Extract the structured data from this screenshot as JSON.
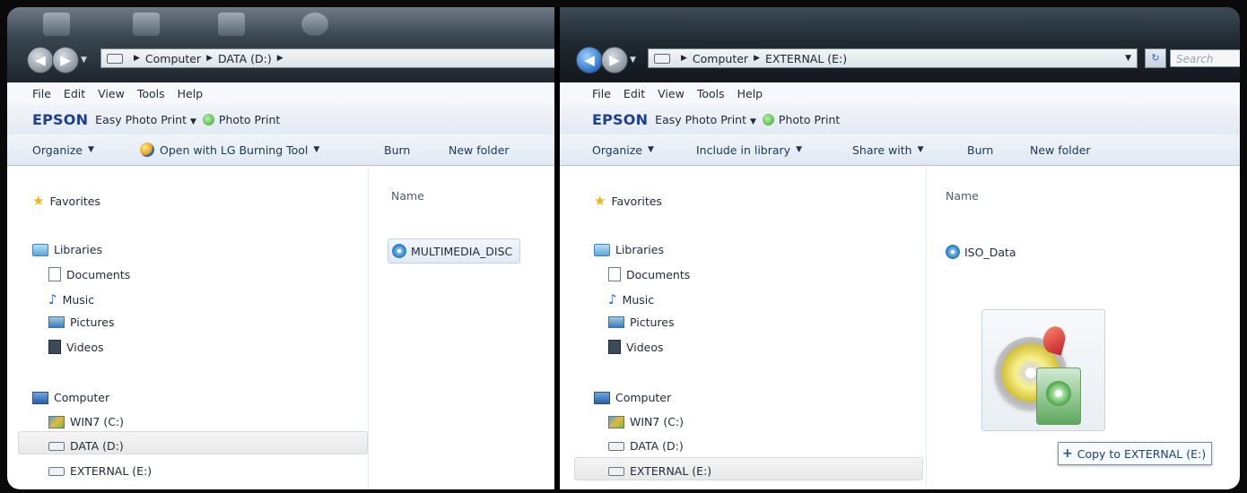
{
  "left_window": {
    "address": [
      "Computer",
      "DATA (D:)"
    ],
    "menu": [
      "File",
      "Edit",
      "View",
      "Tools",
      "Help"
    ],
    "epson": {
      "brand": "EPSON",
      "easy_photo_print": "Easy Photo Print",
      "photo_print": "Photo Print"
    },
    "toolbar": {
      "organize": "Organize",
      "open_with": "Open with LG Burning Tool",
      "burn": "Burn",
      "new_folder": "New folder"
    },
    "nav": {
      "favorites": "Favorites",
      "libraries": "Libraries",
      "documents": "Documents",
      "music": "Music",
      "pictures": "Pictures",
      "videos": "Videos",
      "computer": "Computer",
      "win7": "WIN7 (C:)",
      "data": "DATA (D:)",
      "external": "EXTERNAL (E:)"
    },
    "column_name": "Name",
    "files": [
      "MULTIMEDIA_DISC"
    ],
    "selected_nav": "DATA (D:)"
  },
  "right_window": {
    "address": [
      "Computer",
      "EXTERNAL (E:)"
    ],
    "search_placeholder": "Search",
    "menu": [
      "File",
      "Edit",
      "View",
      "Tools",
      "Help"
    ],
    "epson": {
      "brand": "EPSON",
      "easy_photo_print": "Easy Photo Print",
      "photo_print": "Photo Print"
    },
    "toolbar": {
      "organize": "Organize",
      "include": "Include in library",
      "share": "Share with",
      "burn": "Burn",
      "new_folder": "New folder"
    },
    "nav": {
      "favorites": "Favorites",
      "libraries": "Libraries",
      "documents": "Documents",
      "music": "Music",
      "pictures": "Pictures",
      "videos": "Videos",
      "computer": "Computer",
      "win7": "WIN7 (C:)",
      "data": "DATA (D:)",
      "external": "EXTERNAL (E:)"
    },
    "column_name": "Name",
    "files": [
      "ISO_Data"
    ],
    "selected_nav": "EXTERNAL (E:)",
    "drag_tooltip": "Copy to EXTERNAL (E:)"
  },
  "colors": {
    "epson_blue": "#1c3f94",
    "toolbar_bg": "#dfe8f2",
    "link_blue": "#1e3551"
  }
}
